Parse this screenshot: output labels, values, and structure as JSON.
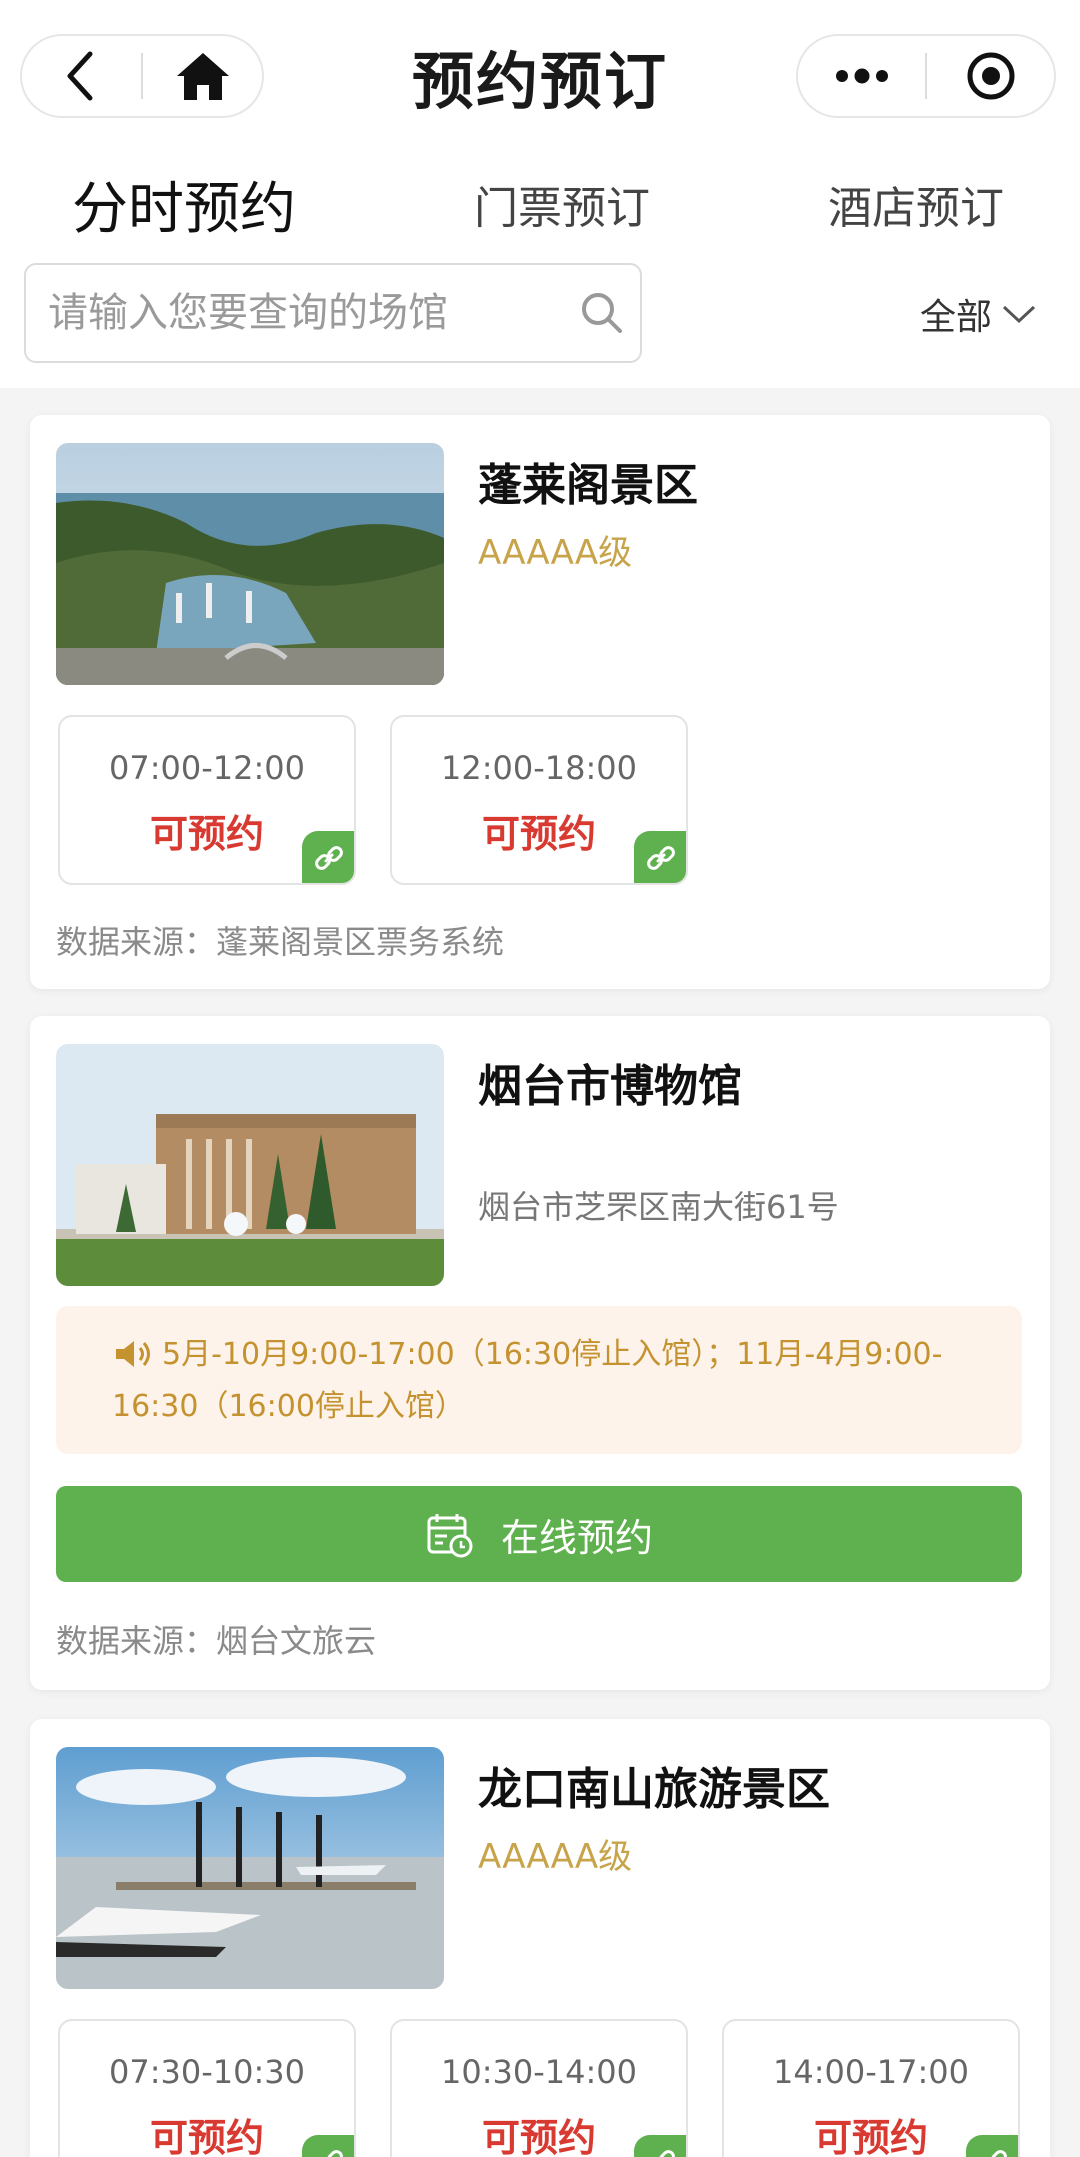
{
  "header": {
    "title": "预约预订"
  },
  "tabs": [
    {
      "label": "分时预约"
    },
    {
      "label": "门票预订"
    },
    {
      "label": "酒店预订"
    }
  ],
  "search": {
    "placeholder": "请输入您要查询的场馆",
    "filter_label": "全部"
  },
  "venues": [
    {
      "name": "蓬莱阁景区",
      "level": "AAAAA级",
      "slots": [
        {
          "time": "07:00-12:00",
          "status": "可预约"
        },
        {
          "time": "12:00-18:00",
          "status": "可预约"
        }
      ],
      "source": "数据来源：蓬莱阁景区票务系统"
    },
    {
      "name": "烟台市博物馆",
      "address": "烟台市芝罘区南大街61号",
      "notice_line1": "5月-10月9:00-17:00（16:30停止入馆）；11月-4月9:00-",
      "notice_line2": "16:30（16:00停止入馆）",
      "button_label": "在线预约",
      "source": "数据来源：烟台文旅云"
    },
    {
      "name": "龙口南山旅游景区",
      "level": "AAAAA级",
      "slots": [
        {
          "time": "07:30-10:30",
          "status": "可预约"
        },
        {
          "time": "10:30-14:00",
          "status": "可预约"
        },
        {
          "time": "14:00-17:00",
          "status": "可预约"
        }
      ]
    }
  ],
  "colors": {
    "accent_green": "#5fb14f",
    "status_red": "#d83a31",
    "level_gold": "#c7a34a"
  }
}
